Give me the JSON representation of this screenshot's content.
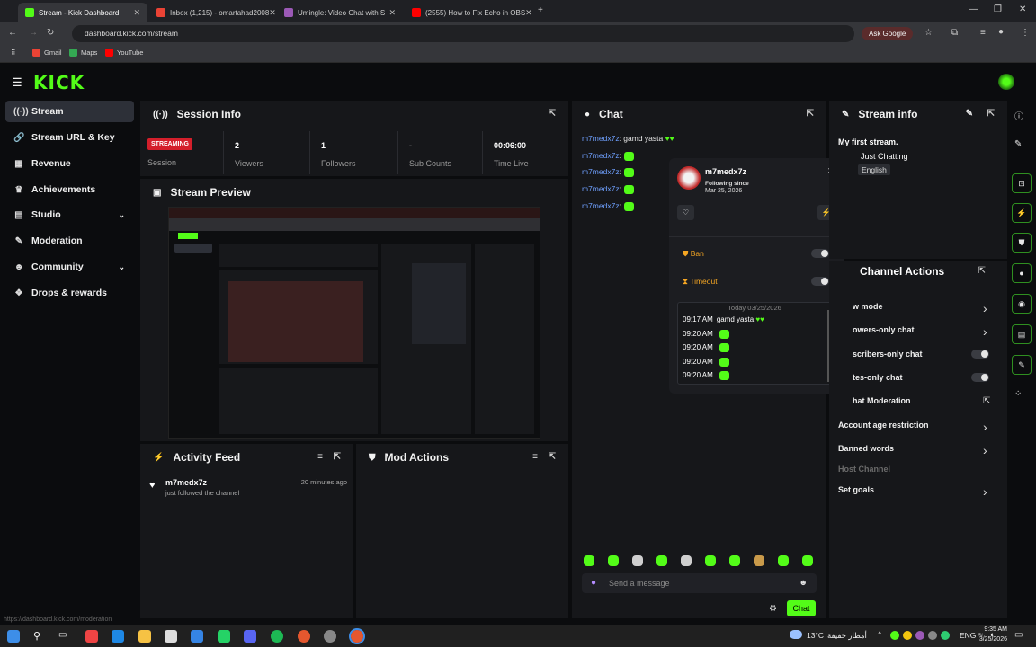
{
  "browser": {
    "tabs": [
      {
        "title": "Stream - Kick Dashboard",
        "active": true,
        "fav_color": "#53fc18"
      },
      {
        "title": "Inbox (1,215) - omartahad2008",
        "active": false,
        "fav_color": "#ea4335"
      },
      {
        "title": "Umingle: Video Chat with S",
        "active": false,
        "fav_color": "#9b59b6"
      },
      {
        "title": "(2555) How to Fix Echo in OBS",
        "active": false,
        "fav_color": "#ff0000"
      }
    ],
    "url": "dashboard.kick.com/stream",
    "ask_google": "Ask Google",
    "bookmarks": [
      {
        "label": "Gmail",
        "color": "#ea4335"
      },
      {
        "label": "Maps",
        "color": "#34a853"
      },
      {
        "label": "YouTube",
        "color": "#ff0000"
      }
    ]
  },
  "app": {
    "logo": "KICK",
    "brand_color": "#53fc18",
    "nav": [
      {
        "label": "Stream",
        "icon": "broadcast-icon",
        "glyph": "((·))",
        "active": true,
        "chevron": false
      },
      {
        "label": "Stream URL & Key",
        "icon": "link-icon",
        "glyph": "🔗",
        "active": false,
        "chevron": false
      },
      {
        "label": "Revenue",
        "icon": "chart-icon",
        "glyph": "▦",
        "active": false,
        "chevron": false
      },
      {
        "label": "Achievements",
        "icon": "trophy-icon",
        "glyph": "♛",
        "active": false,
        "chevron": false
      },
      {
        "label": "Studio",
        "icon": "studio-icon",
        "glyph": "▤",
        "active": false,
        "chevron": true
      },
      {
        "label": "Moderation",
        "icon": "wrench-icon",
        "glyph": "✎",
        "active": false,
        "chevron": false
      },
      {
        "label": "Community",
        "icon": "community-icon",
        "glyph": "☻",
        "active": false,
        "chevron": true
      },
      {
        "label": "Drops & rewards",
        "icon": "gift-icon",
        "glyph": "❖",
        "active": false,
        "chevron": false
      }
    ]
  },
  "session": {
    "title": "Session Info",
    "status": "STREAMING",
    "status_label": "Session",
    "stats": [
      {
        "value": "2",
        "label": "Viewers"
      },
      {
        "value": "1",
        "label": "Followers"
      },
      {
        "value": "-",
        "label": "Sub Counts"
      },
      {
        "value": "00:06:00",
        "label": "Time Live"
      }
    ]
  },
  "preview": {
    "title": "Stream Preview"
  },
  "activity": {
    "title": "Activity Feed",
    "items": [
      {
        "user": "m7medx7z",
        "text": "just followed the channel",
        "time": "20 minutes ago"
      }
    ]
  },
  "mod_actions": {
    "title": "Mod Actions"
  },
  "chat": {
    "title": "Chat",
    "messages": [
      {
        "user": "m7medx7z",
        "text": ": gamd yasta"
      },
      {
        "user": "m7medx7z",
        "text": ":"
      },
      {
        "user": "m7medx7z",
        "text": ":"
      },
      {
        "user": "m7medx7z",
        "text": ":"
      },
      {
        "user": "m7medx7z",
        "text": ":"
      }
    ],
    "input_placeholder": "Send a message",
    "send_label": "Chat"
  },
  "user_card": {
    "username": "m7medx7z",
    "following_since_label": "Following since",
    "following_since": "Mar 25, 2026",
    "ban_label": "Ban",
    "timeout_label": "Timeout",
    "history_date": "Today 03/25/2026",
    "history": [
      {
        "time": "09:17 AM",
        "text": "gamd yasta"
      },
      {
        "time": "09:20 AM",
        "text": ""
      },
      {
        "time": "09:20 AM",
        "text": ""
      },
      {
        "time": "09:20 AM",
        "text": ""
      },
      {
        "time": "09:20 AM",
        "text": ""
      }
    ]
  },
  "stream_info": {
    "title": "Stream info",
    "stream_title": "My first stream.",
    "category": "Just Chatting",
    "language": "English"
  },
  "channel_actions": {
    "title": "Channel Actions",
    "items": [
      {
        "label": "w mode",
        "control": "chevron"
      },
      {
        "label": "owers-only chat",
        "control": "chevron"
      },
      {
        "label": "scribers-only chat",
        "control": "toggle"
      },
      {
        "label": "tes-only chat",
        "control": "toggle"
      },
      {
        "label": "hat Moderation",
        "control": "external"
      },
      {
        "label": "Account age restriction",
        "control": "chevron"
      },
      {
        "label": "Banned words",
        "control": "chevron"
      },
      {
        "label": "Host Channel",
        "control": "disabled"
      },
      {
        "label": "Set goals",
        "control": "chevron"
      }
    ]
  },
  "taskbar": {
    "weather": "13°C",
    "weather_text": "أمطار خفيفة",
    "lang": "ENG",
    "time": "9:35 AM",
    "date": "3/25/2026"
  },
  "status_url": "https://dashboard.kick.com/moderation"
}
